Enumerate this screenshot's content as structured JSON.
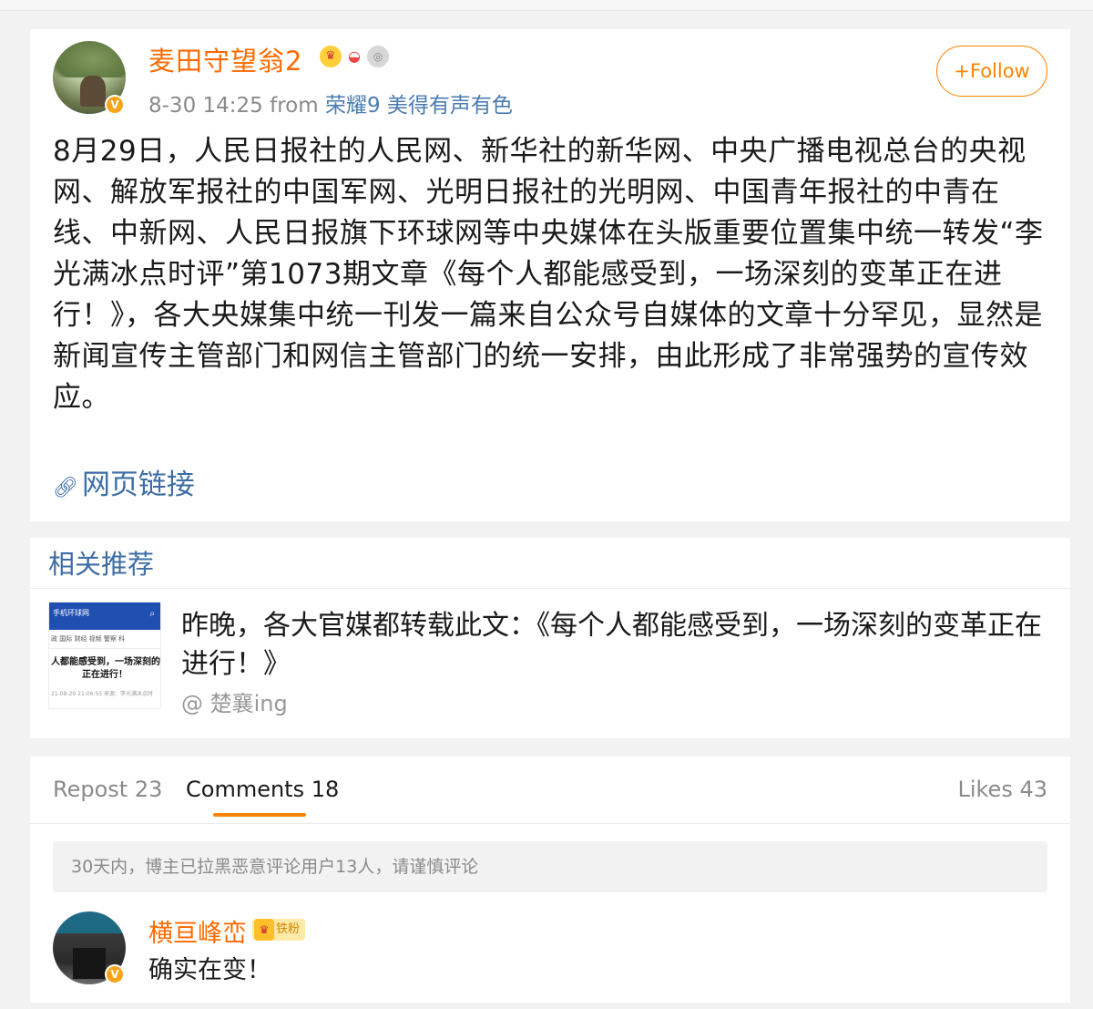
{
  "post": {
    "username": "麦田守望翁2",
    "badges": [
      "crown-badge",
      "rainbow-badge",
      "medal-badge"
    ],
    "time": "8-30 14:25",
    "from_label": "from",
    "source": "荣耀9 美得有声有色",
    "follow_label": "+Follow",
    "verified_mark": "V",
    "text": "8月29日，人民日报社的人民网、新华社的新华网、中央广播电视总台的央视网、解放军报社的中国军网、光明日报社的光明网、中国青年报社的中青在线、中新网、人民日报旗下环球网等中央媒体在头版重要位置集中统一转发“李光满冰点时评”第1073期文章《每个人都能感受到，一场深刻的变革正在进行！》，各大央媒集中统一刊发一篇来自公众号自媒体的文章十分罕见，显然是新闻宣传主管部门和网信主管部门的统一安排，由此形成了非常强势的宣传效应。",
    "link_label": "网页链接"
  },
  "related": {
    "title": "相关推荐",
    "item": {
      "text": "昨晚，各大官媒都转载此文：《每个人都能感受到，一场深刻的变革正在进行！》",
      "author": "@ 楚襄ing",
      "thumb": {
        "logo": "手机环球网",
        "nav": "政 国际 财经 视频 警察 科",
        "headline_1": "人都能感受到，一场深刻的",
        "headline_2": "正在进行！",
        "date": "21-08-29 21:06:55 来源：李光满冰点时"
      }
    }
  },
  "comments": {
    "tabs": {
      "repost": "Repost 23",
      "comments": "Comments 18",
      "likes": "Likes 43"
    },
    "notice": "30天内，博主已拉黑恶意评论用户13人，请谨慎评论",
    "first": {
      "username": "横亘峰峦",
      "fan_badge": "铁粉",
      "text": "确实在变！",
      "verified_mark": "V"
    }
  },
  "colors": {
    "accent": "#ff8200",
    "username": "#ff6a00",
    "link": "#3d6da5"
  }
}
